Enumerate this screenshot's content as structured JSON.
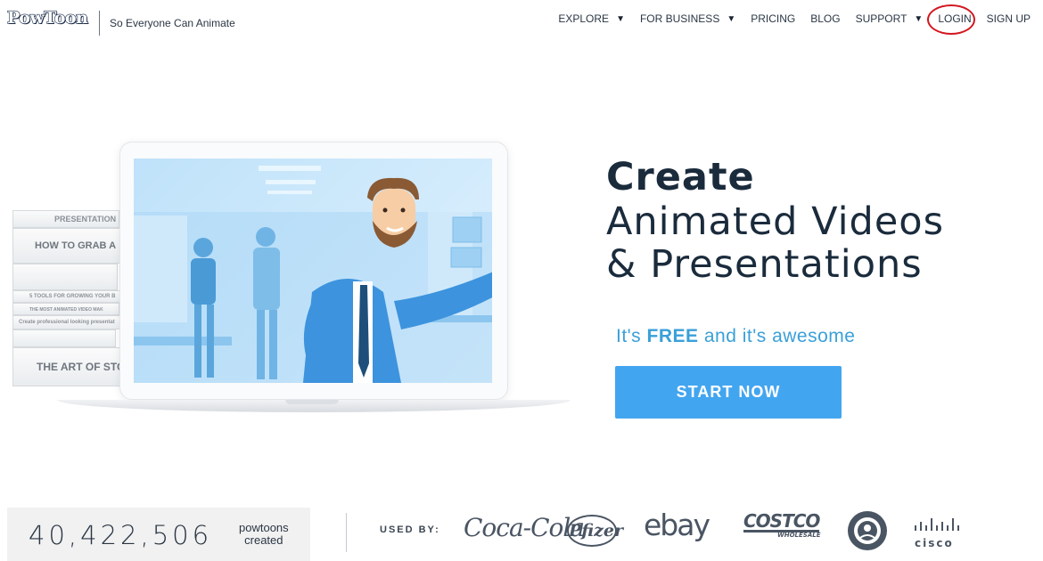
{
  "header": {
    "logo_text": "PowToon",
    "tagline": "So Everyone Can Animate",
    "nav": [
      {
        "label": "EXPLORE",
        "caret": "▼"
      },
      {
        "label": "FOR BUSINESS",
        "caret": "▼"
      },
      {
        "label": "PRICING",
        "caret": ""
      },
      {
        "label": "BLOG",
        "caret": ""
      },
      {
        "label": "SUPPORT",
        "caret": "▼"
      },
      {
        "label": "LOGIN",
        "caret": ""
      },
      {
        "label": "SIGN UP",
        "caret": ""
      }
    ]
  },
  "hero": {
    "books": [
      "PRESENTATION",
      "HOW TO GRAB A",
      "5 TOOLS FOR GROWING YOUR B",
      "THE MOST ANIMATED VIDEO MAK",
      "Create professional looking presentat",
      "THE ART OF STORY"
    ],
    "headline_bold": "Create",
    "headline_line2": "Animated Videos",
    "headline_line3": "& Presentations",
    "free_prefix": "It's ",
    "free_bold": "FREE",
    "free_suffix": " and it's awesome",
    "cta_label": "START NOW"
  },
  "footer": {
    "counter_value": "40,422,506",
    "counter_label_1": "powtoons",
    "counter_label_2": "created",
    "used_by": "USED BY:",
    "brands": [
      "Coca-Cola",
      "Pfizer",
      "ebay",
      "COSTCO",
      "WHOLESALE",
      "Starbucks",
      "cisco"
    ]
  },
  "colors": {
    "accent": "#42a5f0",
    "free_text": "#3aa0d8",
    "login_highlight": "#d3161e",
    "headline": "#1a2b3c"
  }
}
